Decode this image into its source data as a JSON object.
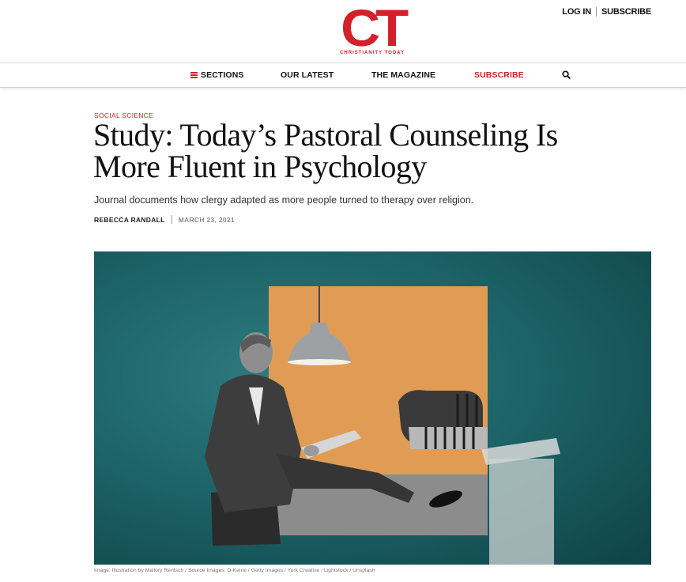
{
  "header": {
    "logo_text": "CT",
    "logo_subtext": "CHRISTIANITY TODAY",
    "login_label": "LOG IN",
    "subscribe_label": "SUBSCRIBE"
  },
  "nav": {
    "sections_label": "SECTIONS",
    "latest_label": "OUR LATEST",
    "magazine_label": "THE MAGAZINE",
    "subscribe_label": "SUBSCRIBE",
    "search_icon": "search-icon",
    "subscribe_color": "#d3202a"
  },
  "article": {
    "kicker": "SOCIAL SCIENCE",
    "headline": "Study: Today’s Pastoral Counseling Is More Fluent in Psychology",
    "dek": "Journal documents how clergy adapted as more people turned to therapy over religion.",
    "author": "REBECCA RANDALL",
    "date": "MARCH 23, 2021",
    "image_caption": "Image: Illustration by Mallory Rentsch / Source Images: D-Keine / Getty Images / York Creative / Lightstock / Unsplash"
  },
  "colors": {
    "brand_red": "#d3202a",
    "hero_teal": "#1d6468",
    "hero_orange": "#e19c55"
  }
}
